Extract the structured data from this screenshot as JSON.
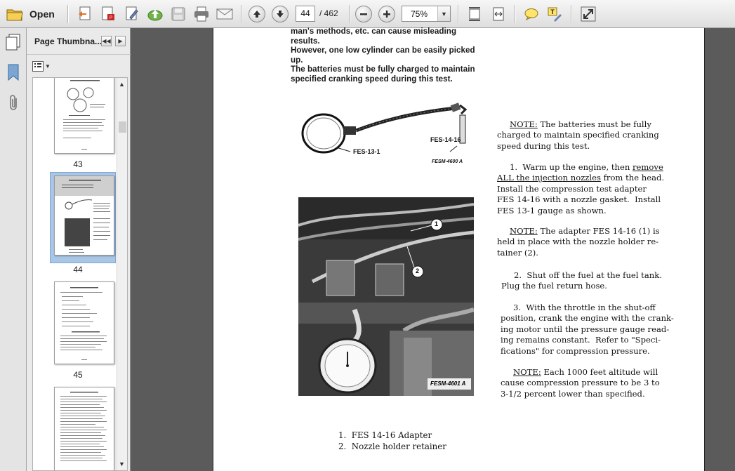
{
  "toolbar": {
    "open_label": "Open",
    "page_current": "44",
    "page_total": "/ 462",
    "zoom": "75%",
    "icons": [
      "folder-icon",
      "create-pdf-icon",
      "export-icon",
      "sign-icon",
      "upload-icon",
      "save-icon",
      "print-icon",
      "email-icon",
      "previous-page-icon",
      "next-page-icon",
      "zoom-out-icon",
      "zoom-in-icon",
      "fit-page-icon",
      "fit-width-icon",
      "comment-icon",
      "highlight-icon",
      "fullscreen-icon"
    ]
  },
  "panel": {
    "title": "Page Thumbna...",
    "thumbs": [
      {
        "label": "43"
      },
      {
        "label": "44",
        "selected": true
      },
      {
        "label": "45"
      },
      {
        "label": ""
      }
    ]
  },
  "document": {
    "top_lines": [
      "man's methods, etc. can cause misleading results.",
      "However, one low cylinder can be easily picked up.",
      "The batteries must be fully charged to maintain",
      "specified cranking speed during this test."
    ],
    "figure1": {
      "gauge_label": "FES-13-1",
      "adapter_label": "FES-14-16",
      "code": "FESM-4600 A"
    },
    "figure2": {
      "code": "FESM-4601 A",
      "callout1": "1",
      "callout2": "2"
    },
    "note1": {
      "head": "NOTE:",
      "rest": " The batteries must be fully",
      "lines": [
        "charged to maintain specified cranking",
        "speed during this test."
      ]
    },
    "step1": {
      "line1_a": "1.  Warm up the engine, then ",
      "line1_u": "remove",
      "line2_u": "ALL the injection nozzles",
      "line2_b": " from the head.",
      "lines": [
        "Install the compression test adapter",
        "FES 14-16 with a nozzle gasket.  Install",
        "FES 13-1 gauge as shown."
      ]
    },
    "note2": {
      "head": "NOTE:",
      "rest": " The adapter FES 14-16 (1) is",
      "lines": [
        "held in place with the nozzle holder re-",
        "tainer (2)."
      ]
    },
    "step2": {
      "lines": [
        "2.  Shut off the fuel at the fuel tank.",
        "Plug the fuel return hose."
      ]
    },
    "step3": {
      "lines": [
        "3.  With the throttle in the shut-off",
        "position, crank the engine with the crank-",
        "ing motor until the pressure gauge read-",
        "ing remains constant.  Refer to \"Speci-",
        "fications\" for compression pressure."
      ]
    },
    "note3": {
      "head": "NOTE:",
      "rest": " Each 1000 feet altitude will",
      "lines": [
        "cause compression pressure to be 3 to",
        "3-1/2 percent lower than specified."
      ]
    },
    "captions": [
      "1.  FES 14-16 Adapter",
      "2.  Nozzle holder retainer"
    ]
  }
}
